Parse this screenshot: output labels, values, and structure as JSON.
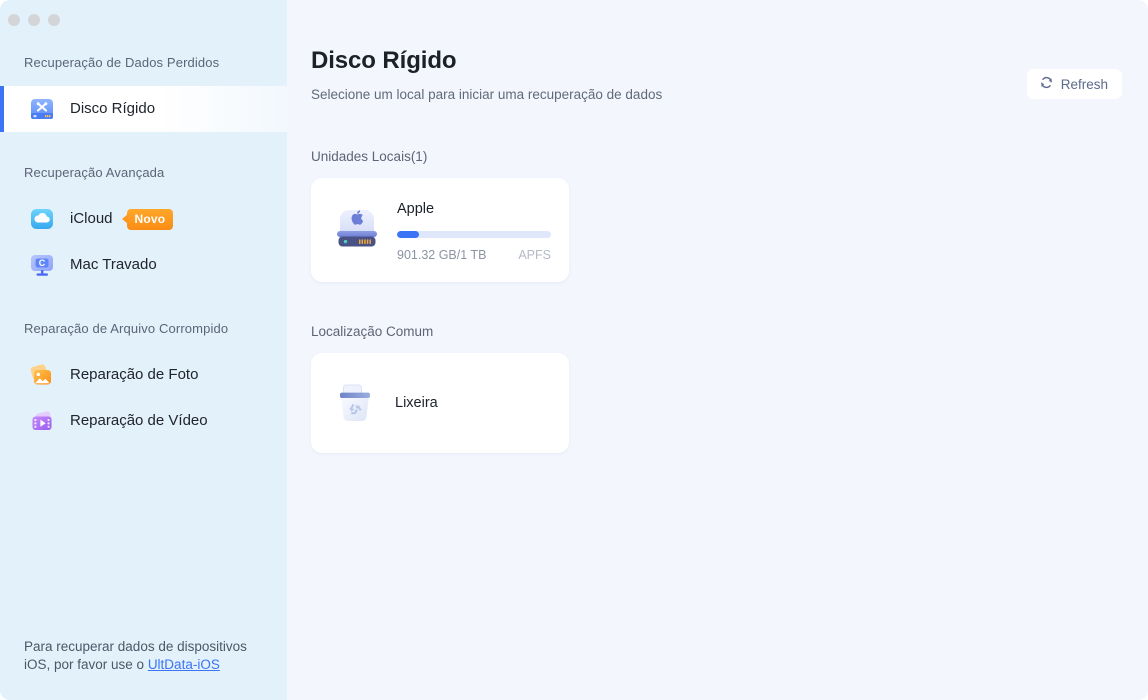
{
  "window": {
    "traffic_lights": [
      "close",
      "minimize",
      "maximize"
    ]
  },
  "sidebar": {
    "sections": [
      {
        "label": "Recuperação de Dados Perdidos"
      },
      {
        "label": "Recuperação Avançada"
      },
      {
        "label": "Reparação de Arquivo Corrompido"
      }
    ],
    "items": [
      {
        "label": "Disco Rígido",
        "icon": "hard-drive-tools-icon",
        "active": true
      },
      {
        "label": "iCloud",
        "icon": "icloud-icon",
        "badge": "Novo"
      },
      {
        "label": "Mac Travado",
        "icon": "locked-mac-icon"
      },
      {
        "label": "Reparação de Foto",
        "icon": "photo-repair-icon"
      },
      {
        "label": "Reparação de Vídeo",
        "icon": "video-repair-icon"
      }
    ],
    "footer": {
      "text_before": "Para recuperar dados de dispositivos iOS, por favor use o ",
      "link_text": "UltData-iOS"
    }
  },
  "main": {
    "title": "Disco Rígido",
    "subtitle": "Selecione um local para iniciar uma recuperação de dados",
    "refresh_label": "Refresh",
    "groups": [
      {
        "label": "Unidades Locais(1)",
        "drives": [
          {
            "name": "Apple",
            "used_total": "901.32 GB/1 TB",
            "filesystem": "APFS",
            "fill_percent": 14
          }
        ]
      },
      {
        "label": "Localização Comum",
        "locations": [
          {
            "label": "Lixeira",
            "icon": "trash-icon"
          }
        ]
      }
    ]
  },
  "colors": {
    "accent": "#3b74f5",
    "sidebar_bg": "#e3f1fb",
    "main_bg": "#f3f6fd",
    "badge_orange": "#fb8c16",
    "card_bg": "#ffffff"
  }
}
